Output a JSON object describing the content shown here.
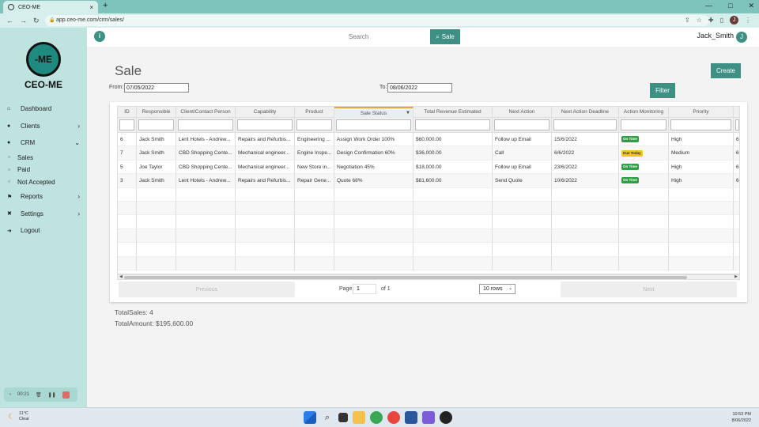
{
  "browser": {
    "tab_title": "CEO-ME",
    "tab_close": "×",
    "new_tab": "+",
    "url": "app.ceo-me.com/crm/sales/",
    "profile_initial": "J",
    "win_minimize": "—",
    "win_maximize": "□",
    "win_close": "✕"
  },
  "sidebar": {
    "logo_mark": "-ME",
    "logo_text": "CEO-ME",
    "items": [
      {
        "label": "Dashboard",
        "icon": "home-icon"
      },
      {
        "label": "Clients",
        "icon": "user-icon"
      },
      {
        "label": "CRM",
        "icon": "user-icon"
      },
      {
        "label": "Reports",
        "icon": "flag-icon"
      },
      {
        "label": "Settings",
        "icon": "tools-icon"
      },
      {
        "label": "Logout",
        "icon": "logout-icon"
      }
    ],
    "sub_items": [
      "Sales",
      "Paid",
      "Not Accepted"
    ],
    "recorder_time": "00:21"
  },
  "topbar": {
    "info_icon": "i",
    "search_placeholder": "Search",
    "search_button": "Sale",
    "username": "Jack_Smith",
    "avatar_initial": "J"
  },
  "page": {
    "title": "Sale",
    "create_button": "Create",
    "filter_button": "Filter",
    "from_label": "From:",
    "from_value": "07/05/2022",
    "to_label": "To:",
    "to_value": "08/06/2022"
  },
  "table": {
    "columns": [
      "ID",
      "Responsible",
      "Client/Contact Person",
      "Capability",
      "Product",
      "Sale Status",
      "Total Revenue Estimated",
      "Next Action",
      "Next Action Deadline",
      "Action Monitoring",
      "Priority",
      ""
    ],
    "rows": [
      [
        "6",
        "Jack Smith",
        "Lent Hotels - Andrew...",
        "Repairs and Refurbis...",
        "Engineering ...",
        "Assign Work Order 100%",
        "$60,000.00",
        "Follow up Email",
        "15/6/2022",
        "On Time",
        "High",
        "6"
      ],
      [
        "7",
        "Jack Smith",
        "CBD Shopping Cente...",
        "Mechanical engineer...",
        "Engine Inspe...",
        "Design Confirmation 60%",
        "$36,000.00",
        "Call",
        "6/6/2022",
        "Due Today",
        "Medium",
        "6"
      ],
      [
        "5",
        "Joe Taylor",
        "CBD Shopping Cente...",
        "Mechanical engineer...",
        "New Store in...",
        "Negotiation 45%",
        "$18,000.00",
        "Follow up Email",
        "23/6/2022",
        "On Time",
        "High",
        "6"
      ],
      [
        "3",
        "Jack Smith",
        "Lent Hotels - Andrew...",
        "Repairs and Refurbis...",
        "Repair Gene...",
        "Quote 68%",
        "$81,600.00",
        "Send Quote",
        "10/6/2022",
        "On Time",
        "High",
        "6"
      ]
    ],
    "badge_colors": {
      "On Time": "#2e9e44",
      "Due Today": "#f0c419"
    },
    "pagination": {
      "previous": "Previous",
      "page_label": "Page",
      "page_value": "1",
      "of_label": "of 1",
      "rows_select": "10 rows",
      "next": "Next"
    }
  },
  "totals": {
    "sales": "TotalSales: 4",
    "amount": "TotalAmount: $195,600.00"
  },
  "taskbar": {
    "temp": "11°C",
    "weather": "Clear",
    "time": "10:53 PM",
    "date": "8/06/2022"
  },
  "colors": {
    "accent": "#3e8f84",
    "sidebar": "#bfe3df",
    "browser": "#7fc3bd"
  }
}
